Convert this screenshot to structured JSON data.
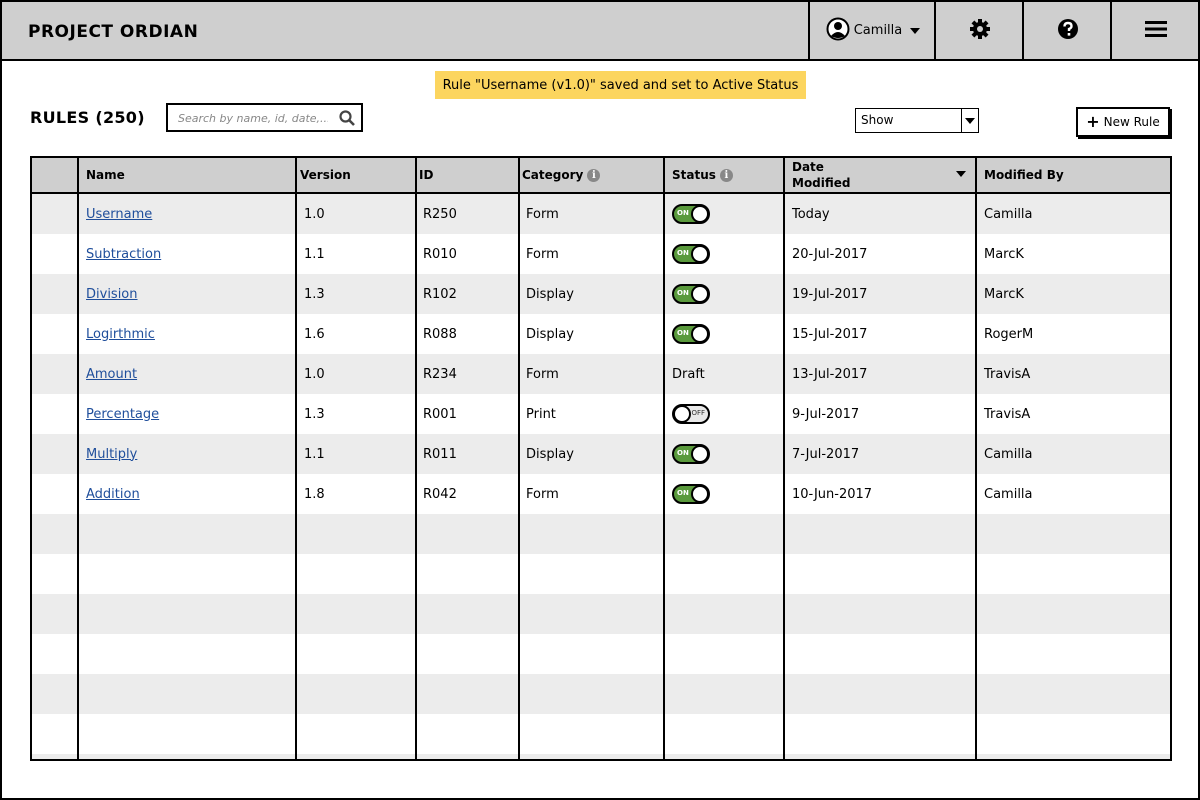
{
  "header": {
    "title": "PROJECT ORDIAN",
    "user": "Camilla"
  },
  "notice": "Rule \"Username (v1.0)\" saved and set to Active Status",
  "toolbar": {
    "heading": "RULES (250)",
    "search_placeholder": "Search by name, id, date,...",
    "show_value": "Show",
    "new_rule_label": "New Rule"
  },
  "table": {
    "columns": {
      "name": "Name",
      "version": "Version",
      "id": "ID",
      "category": "Category",
      "status": "Status",
      "date_line1": "Date",
      "date_line2": "Modified",
      "modified_by": "Modified By"
    },
    "rows": [
      {
        "name": "Username",
        "version": "1.0",
        "id": "R250",
        "category": "Form",
        "status": "on",
        "status_text": "ON",
        "date": "Today",
        "by": "Camilla"
      },
      {
        "name": "Subtraction",
        "version": "1.1",
        "id": "R010",
        "category": "Form",
        "status": "on",
        "status_text": "ON",
        "date": "20-Jul-2017",
        "by": "MarcK"
      },
      {
        "name": "Division",
        "version": "1.3",
        "id": "R102",
        "category": "Display",
        "status": "on",
        "status_text": "ON",
        "date": "19-Jul-2017",
        "by": "MarcK"
      },
      {
        "name": "Logirthmic",
        "version": "1.6",
        "id": "R088",
        "category": "Display",
        "status": "on",
        "status_text": "ON",
        "date": "15-Jul-2017",
        "by": "RogerM"
      },
      {
        "name": "Amount",
        "version": "1.0",
        "id": "R234",
        "category": "Form",
        "status": "text",
        "status_text": "Draft",
        "date": "13-Jul-2017",
        "by": "TravisA"
      },
      {
        "name": "Percentage",
        "version": "1.3",
        "id": "R001",
        "category": "Print",
        "status": "off",
        "status_text": "OFF",
        "date": "9-Jul-2017",
        "by": "TravisA"
      },
      {
        "name": "Multiply",
        "version": "1.1",
        "id": "R011",
        "category": "Display",
        "status": "on",
        "status_text": "ON",
        "date": "7-Jul-2017",
        "by": "Camilla"
      },
      {
        "name": "Addition",
        "version": "1.8",
        "id": "R042",
        "category": "Form",
        "status": "on",
        "status_text": "ON",
        "date": "10-Jun-2017",
        "by": "Camilla"
      }
    ]
  },
  "colors": {
    "header_bg": "#cfcfcf",
    "notice_bg": "#fcd55f",
    "toggle_on": "#5a9a3c",
    "link": "#1f4e9b",
    "row_alt": "#ececec"
  },
  "icons": {
    "user": "user-circle-icon",
    "settings": "gear-icon",
    "help": "question-circle-icon",
    "menu": "hamburger-menu-icon",
    "search": "search-icon",
    "info": "info-icon",
    "plus": "plus-icon",
    "dropdown": "dropdown-arrow-icon"
  }
}
